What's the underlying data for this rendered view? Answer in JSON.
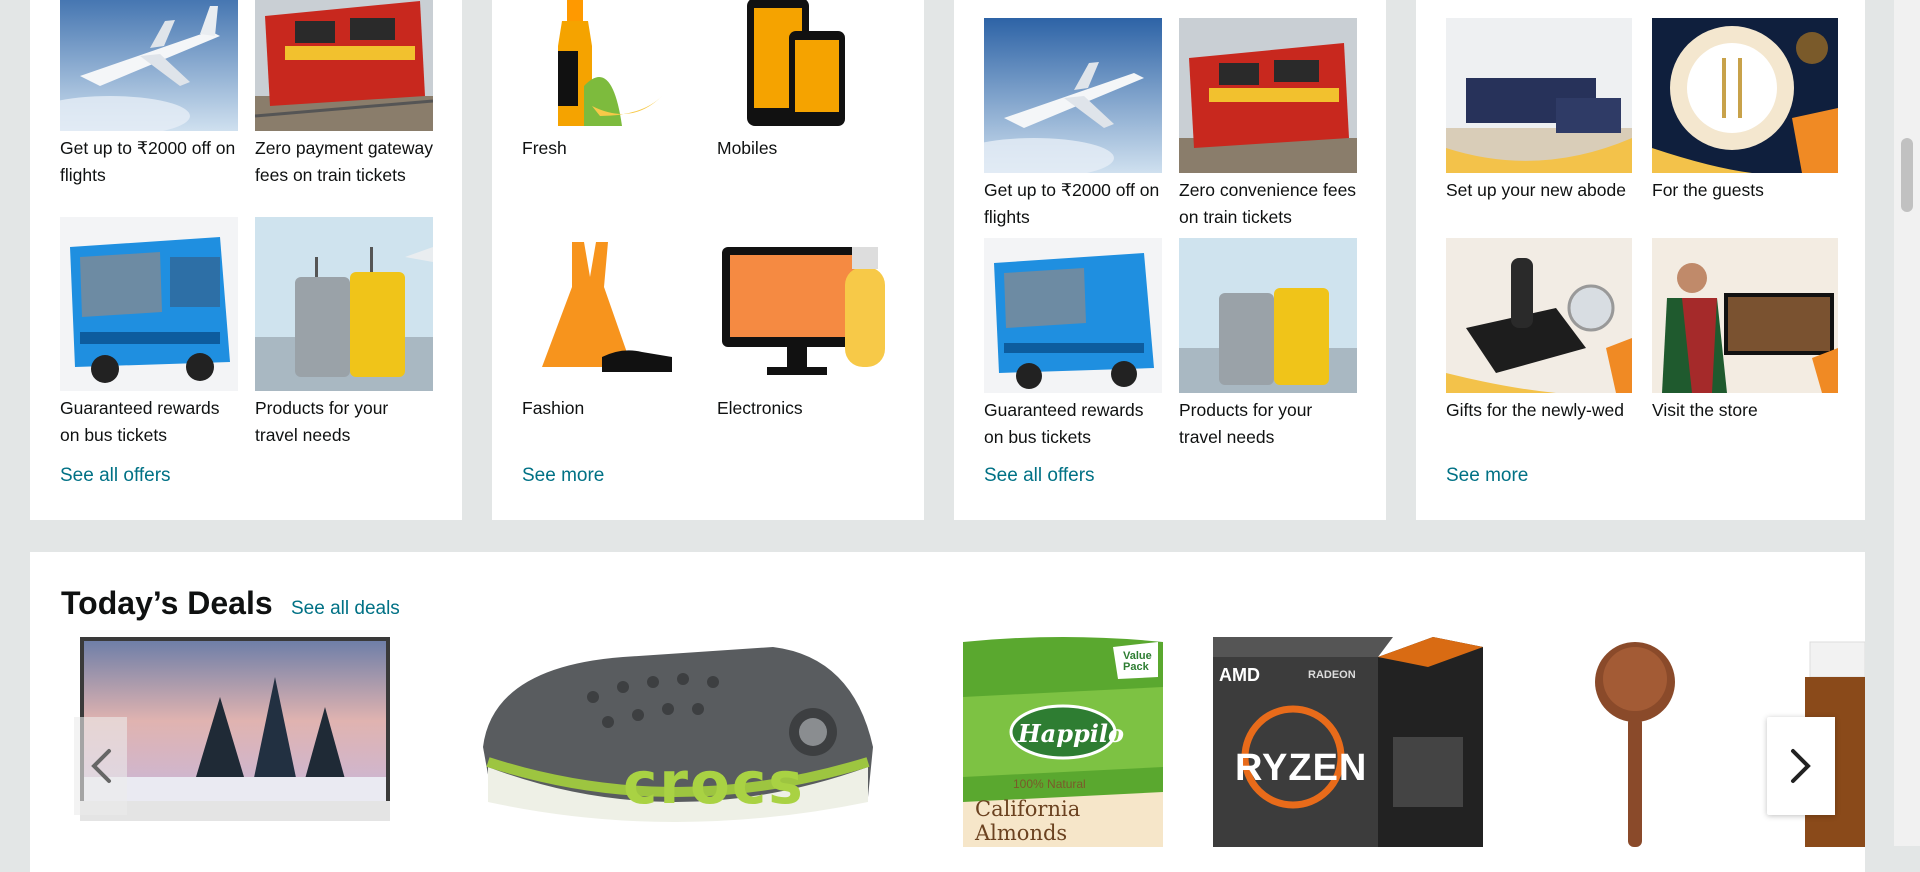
{
  "cards": [
    {
      "tiles": [
        {
          "caption": "Get up to ₹2000 off on flights",
          "image": "airplane-photo"
        },
        {
          "caption": "Zero payment gateway fees on train tickets",
          "image": "train-photo"
        },
        {
          "caption": "Guaranteed rewards on bus tickets",
          "image": "bus-photo"
        },
        {
          "caption": "Products for your travel needs",
          "image": "luggage-photo"
        }
      ],
      "link": "See all offers"
    },
    {
      "tiles": [
        {
          "caption": "Fresh",
          "image": "bottle-bananas-icon"
        },
        {
          "caption": "Mobiles",
          "image": "phones-icon"
        },
        {
          "caption": "Fashion",
          "image": "dress-shoe-icon"
        },
        {
          "caption": "Electronics",
          "image": "monitor-usb-icon"
        }
      ],
      "link": "See more"
    },
    {
      "tiles": [
        {
          "caption": "Get up to ₹2000 off on flights",
          "image": "airplane-photo"
        },
        {
          "caption": "Zero convenience fees on train tickets",
          "image": "train-photo"
        },
        {
          "caption": "Guaranteed rewards on bus tickets",
          "image": "bus-photo"
        },
        {
          "caption": "Products for your travel needs",
          "image": "luggage-photo"
        }
      ],
      "link": "See all offers"
    },
    {
      "tiles": [
        {
          "caption": "Set up your new abode",
          "image": "sofa-photo"
        },
        {
          "caption": "For the guests",
          "image": "dinnerware-photo"
        },
        {
          "caption": "Gifts for the newly-wed",
          "image": "trimmer-watch-photo"
        },
        {
          "caption": "Visit the store",
          "image": "saree-tv-photo"
        }
      ],
      "link": "See more"
    }
  ],
  "deals": {
    "title": "Today’s Deals",
    "link": "See all deals",
    "items": [
      {
        "image": "monitor-snow-photo"
      },
      {
        "image": "crocs-clog-photo",
        "brand": "crocs"
      },
      {
        "image": "almonds-pack-photo",
        "brand": "Happilo",
        "badge": "Value Pack",
        "subtitle": "100% Natural",
        "product": "California Almonds"
      },
      {
        "image": "ryzen-box-photo",
        "brand": "AMD",
        "product": "RYZEN",
        "sub": "RADEON"
      },
      {
        "image": "wooden-spoon-photo"
      }
    ]
  },
  "colors": {
    "link": "#007185",
    "page_bg": "#e3e6e6",
    "text": "#0f1111"
  }
}
